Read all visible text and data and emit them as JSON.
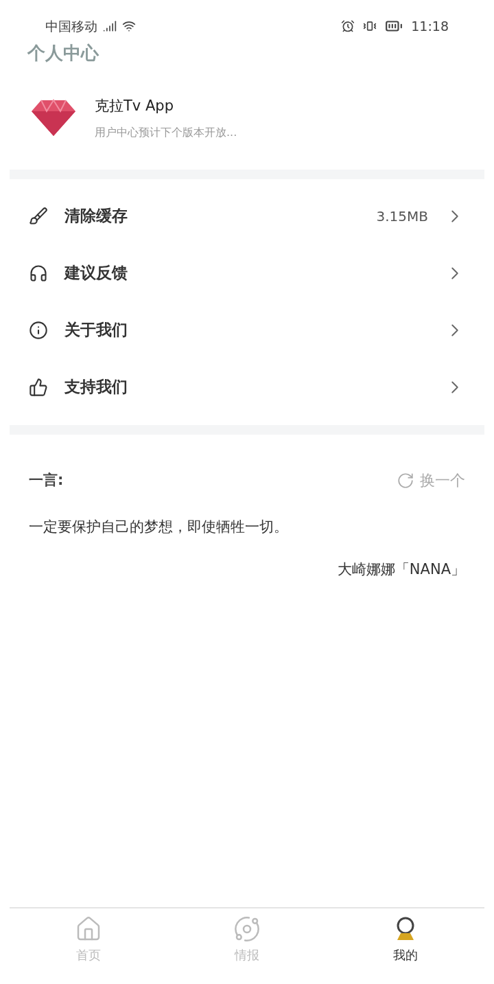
{
  "status_bar": {
    "carrier": "中国移动",
    "time": "11:18"
  },
  "title": "个人中心",
  "profile": {
    "name": "克拉Tv App",
    "subtitle": "用户中心预计下个版本开放..."
  },
  "menu": [
    {
      "kind": "clean",
      "label": "清除缓存",
      "value": "3.15MB"
    },
    {
      "kind": "feedback",
      "label": "建议反馈"
    },
    {
      "kind": "about",
      "label": "关于我们"
    },
    {
      "kind": "support",
      "label": "支持我们"
    }
  ],
  "quote": {
    "heading": "一言:",
    "refresh": "换一个",
    "text": "一定要保护自己的梦想，即使牺牲一切。",
    "author": "大崎娜娜「NANA」"
  },
  "tabs": [
    {
      "kind": "home",
      "label": "首页",
      "selected": false
    },
    {
      "kind": "planet",
      "label": "情报",
      "selected": false
    },
    {
      "kind": "user",
      "label": "我的",
      "selected": true
    }
  ]
}
